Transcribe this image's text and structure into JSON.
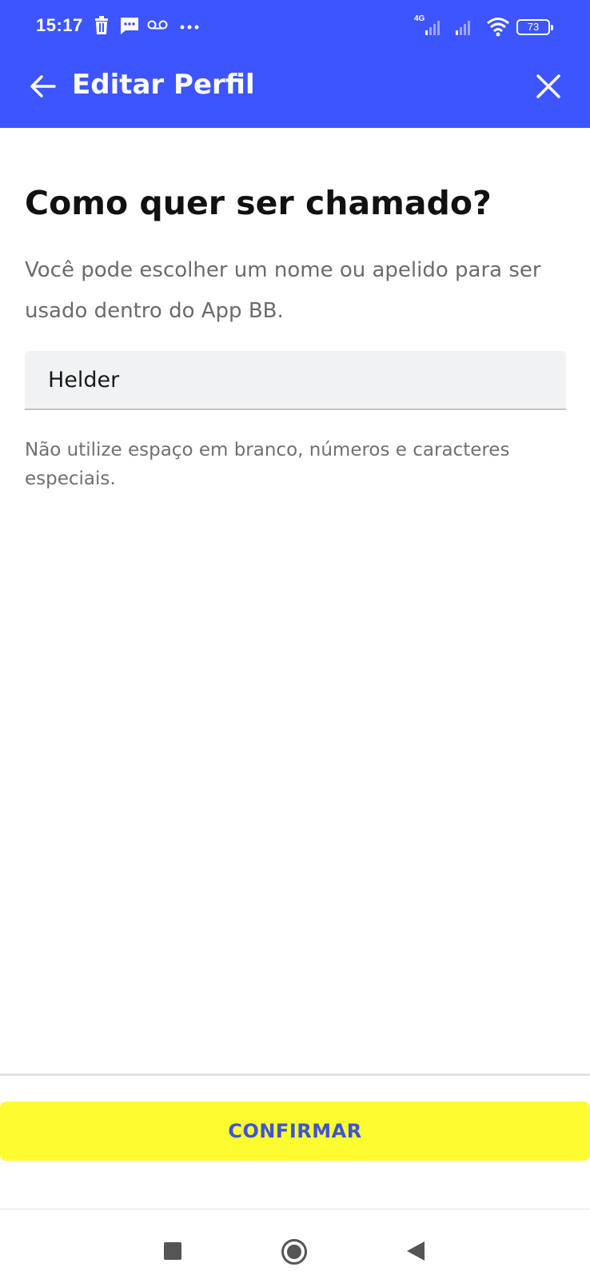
{
  "status_bar": {
    "time": "15:17",
    "network_label": "4G",
    "battery_level": "73"
  },
  "app_bar": {
    "title": "Editar Perfil"
  },
  "main": {
    "heading": "Como quer ser chamado?",
    "subtitle": "Você pode escolher um nome ou apelido para ser usado dentro do App BB.",
    "name_field_value": "Helder",
    "hint": "Não utilize espaço em branco, números e caracteres especiais."
  },
  "footer": {
    "confirm_label": "CONFIRMAR"
  },
  "colors": {
    "header": "#3d55ff",
    "confirm_button": "#fcfc30",
    "confirm_text": "#3d55d8"
  }
}
